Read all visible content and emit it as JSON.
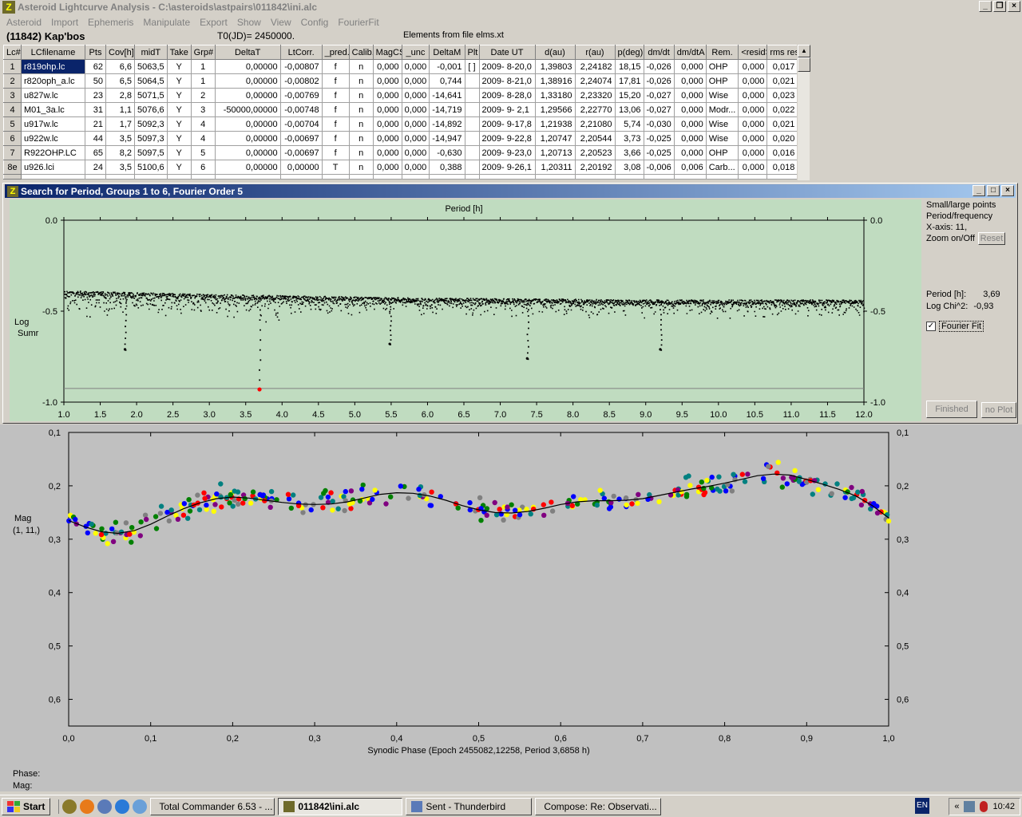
{
  "window": {
    "title": "Asteroid Lightcurve Analysis - C:\\asteroids\\astpairs\\011842\\ini.alc"
  },
  "menu": [
    "Asteroid",
    "Import",
    "Ephemeris",
    "Manipulate",
    "Export",
    "Show",
    "View",
    "Config",
    "FourierFit"
  ],
  "info": {
    "object": "(11842) Kap'bos",
    "t0": "T0(JD)= 2450000.",
    "elements": "Elements from file elms.xt"
  },
  "table": {
    "headers": [
      "Lc#",
      "LCfilename",
      "Pts",
      "Cov[h]",
      "midT",
      "Take",
      "Grp#",
      "DeltaT",
      "LtCorr.",
      "_pred.",
      "Calib.",
      "MagCS",
      "_unc",
      "DeltaM",
      "Plt",
      "Date UT",
      "d(au)",
      "r(au)",
      "p(deg)",
      "dm/dt",
      "dm/dtA",
      "Rem.",
      "<resid>",
      "rms res"
    ],
    "rows": [
      [
        "1",
        "r819ohp.lc",
        "62",
        "6,6",
        "5063,5",
        "Y",
        "1",
        "0,00000",
        "-0,00807",
        "f",
        "n",
        "0,000",
        "0,000",
        "-0,001",
        "[ ]",
        "2009- 8-20,0",
        "1,39803",
        "2,24182",
        "18,15",
        "-0,026",
        "0,000",
        "OHP",
        "0,000",
        "0,017"
      ],
      [
        "2",
        "r820oph_a.lc",
        "50",
        "6,5",
        "5064,5",
        "Y",
        "1",
        "0,00000",
        "-0,00802",
        "f",
        "n",
        "0,000",
        "0,000",
        "0,744",
        "",
        "2009- 8-21,0",
        "1,38916",
        "2,24074",
        "17,81",
        "-0,026",
        "0,000",
        "OHP",
        "0,000",
        "0,021"
      ],
      [
        "3",
        "u827w.lc",
        "23",
        "2,8",
        "5071,5",
        "Y",
        "2",
        "0,00000",
        "-0,00769",
        "f",
        "n",
        "0,000",
        "0,000",
        "-14,641",
        "",
        "2009- 8-28,0",
        "1,33180",
        "2,23320",
        "15,20",
        "-0,027",
        "0,000",
        "Wise",
        "0,000",
        "0,023"
      ],
      [
        "4",
        "M01_3a.lc",
        "31",
        "1,1",
        "5076,6",
        "Y",
        "3",
        "-50000,00000",
        "-0,00748",
        "f",
        "n",
        "0,000",
        "0,000",
        "-14,719",
        "",
        "2009- 9- 2,1",
        "1,29566",
        "2,22770",
        "13,06",
        "-0,027",
        "0,000",
        "Modr...",
        "0,000",
        "0,022"
      ],
      [
        "5",
        "u917w.lc",
        "21",
        "1,7",
        "5092,3",
        "Y",
        "4",
        "0,00000",
        "-0,00704",
        "f",
        "n",
        "0,000",
        "0,000",
        "-14,892",
        "",
        "2009- 9-17,8",
        "1,21938",
        "2,21080",
        "5,74",
        "-0,030",
        "0,000",
        "Wise",
        "0,000",
        "0,021"
      ],
      [
        "6",
        "u922w.lc",
        "44",
        "3,5",
        "5097,3",
        "Y",
        "4",
        "0,00000",
        "-0,00697",
        "f",
        "n",
        "0,000",
        "0,000",
        "-14,947",
        "",
        "2009- 9-22,8",
        "1,20747",
        "2,20544",
        "3,73",
        "-0,025",
        "0,000",
        "Wise",
        "0,000",
        "0,020"
      ],
      [
        "7",
        "R922OHP.LC",
        "65",
        "8,2",
        "5097,5",
        "Y",
        "5",
        "0,00000",
        "-0,00697",
        "f",
        "n",
        "0,000",
        "0,000",
        "-0,630",
        "",
        "2009- 9-23,0",
        "1,20713",
        "2,20523",
        "3,66",
        "-0,025",
        "0,000",
        "OHP",
        "0,000",
        "0,016"
      ],
      [
        "8e",
        "u926.lci",
        "24",
        "3,5",
        "5100,6",
        "Y",
        "6",
        "0,00000",
        "0,00000",
        "T",
        "n",
        "0,000",
        "0,000",
        "0,388",
        "",
        "2009- 9-26,1",
        "1,20311",
        "2,20192",
        "3,08",
        "-0,006",
        "0,006",
        "Carb...",
        "0,000",
        "0,018"
      ]
    ]
  },
  "period_window": {
    "title": "Search for Period, Groups 1 to 6, Fourier Order 5",
    "side": {
      "line1": "Small/large points",
      "line2": "Period/frequency",
      "line3": "X-axis: 11,",
      "line4": "Zoom on/Off",
      "reset": "Reset",
      "period_label": "Period [h]:",
      "period_value": "3,69",
      "chi_label": "Log Chi^2:",
      "chi_value": "-0,93",
      "fourier_label": "Fourier Fit",
      "fourier_checked": "✓",
      "finished": "Finished",
      "noplot": "no Plot"
    }
  },
  "status": {
    "phase": "Phase:",
    "mag": "Mag:"
  },
  "chart_data": [
    {
      "type": "scatter",
      "title": "Period [h]",
      "xlabel": "",
      "ylabel": "Log Sumr",
      "xlim": [
        1.0,
        12.0
      ],
      "ylim": [
        -1.0,
        0.0
      ],
      "xticks": [
        "1.0",
        "1.5",
        "2.0",
        "2.5",
        "3.0",
        "3.5",
        "4.0",
        "4.5",
        "5.0",
        "5.5",
        "6.0",
        "6.5",
        "7.0",
        "7.5",
        "8.0",
        "8.5",
        "9.0",
        "9.5",
        "10.0",
        "10.5",
        "11.0",
        "11.5",
        "12.0"
      ],
      "yticks": [
        "0.0",
        "-0.5",
        "-1.0"
      ],
      "baseline": -0.925,
      "best": {
        "x": 3.69,
        "y": -0.93
      },
      "dips": [
        {
          "x": 1.84,
          "y": -0.71
        },
        {
          "x": 3.69,
          "y": -0.93
        },
        {
          "x": 5.48,
          "y": -0.68
        },
        {
          "x": 7.37,
          "y": -0.76
        },
        {
          "x": 9.2,
          "y": -0.71
        }
      ],
      "envelope": [
        [
          1.0,
          -0.38
        ],
        [
          3.0,
          -0.4
        ],
        [
          6.0,
          -0.42
        ],
        [
          9.0,
          -0.43
        ],
        [
          12.0,
          -0.43
        ]
      ],
      "point_color": "#000000",
      "best_color": "#ff0000",
      "background": "#c0dcc0",
      "grid": false
    },
    {
      "type": "scatter",
      "title": "",
      "xlabel": "Synodic Phase (Epoch 2455082,12258, Period 3,6858 h)",
      "ylabel": "Mag",
      "ylabel2": "(1, 11,)",
      "xlim": [
        0.0,
        1.0
      ],
      "ylim": [
        0.1,
        0.65
      ],
      "y_inverted": true,
      "xticks": [
        "0,0",
        "0,1",
        "0,2",
        "0,3",
        "0,4",
        "0,5",
        "0,6",
        "0,7",
        "0,8",
        "0,9",
        "1,0"
      ],
      "yticks": [
        "0,1",
        "0,2",
        "0,3",
        "0,4",
        "0,5",
        "0,6"
      ],
      "background": "#c0c0c0",
      "grid": false,
      "fit_curve": [
        [
          0.0,
          0.265
        ],
        [
          0.02,
          0.277
        ],
        [
          0.04,
          0.286
        ],
        [
          0.06,
          0.289
        ],
        [
          0.08,
          0.284
        ],
        [
          0.1,
          0.272
        ],
        [
          0.12,
          0.257
        ],
        [
          0.14,
          0.243
        ],
        [
          0.16,
          0.232
        ],
        [
          0.18,
          0.224
        ],
        [
          0.2,
          0.221
        ],
        [
          0.22,
          0.223
        ],
        [
          0.24,
          0.227
        ],
        [
          0.26,
          0.231
        ],
        [
          0.28,
          0.234
        ],
        [
          0.3,
          0.235
        ],
        [
          0.32,
          0.234
        ],
        [
          0.34,
          0.23
        ],
        [
          0.36,
          0.223
        ],
        [
          0.38,
          0.216
        ],
        [
          0.4,
          0.213
        ],
        [
          0.42,
          0.214
        ],
        [
          0.44,
          0.219
        ],
        [
          0.46,
          0.227
        ],
        [
          0.48,
          0.237
        ],
        [
          0.5,
          0.245
        ],
        [
          0.52,
          0.25
        ],
        [
          0.54,
          0.251
        ],
        [
          0.56,
          0.248
        ],
        [
          0.58,
          0.242
        ],
        [
          0.6,
          0.235
        ],
        [
          0.62,
          0.23
        ],
        [
          0.64,
          0.228
        ],
        [
          0.66,
          0.228
        ],
        [
          0.68,
          0.227
        ],
        [
          0.7,
          0.224
        ],
        [
          0.72,
          0.218
        ],
        [
          0.74,
          0.212
        ],
        [
          0.76,
          0.206
        ],
        [
          0.78,
          0.201
        ],
        [
          0.8,
          0.195
        ],
        [
          0.82,
          0.188
        ],
        [
          0.84,
          0.181
        ],
        [
          0.86,
          0.178
        ],
        [
          0.88,
          0.18
        ],
        [
          0.9,
          0.188
        ],
        [
          0.92,
          0.197
        ],
        [
          0.94,
          0.207
        ],
        [
          0.96,
          0.219
        ],
        [
          0.98,
          0.237
        ],
        [
          1.0,
          0.26
        ]
      ],
      "series_colors": [
        "#ff0000",
        "#008000",
        "#0000ff",
        "#ffff00",
        "#808080",
        "#008080",
        "#800080"
      ],
      "noise": 0.03
    }
  ]
}
